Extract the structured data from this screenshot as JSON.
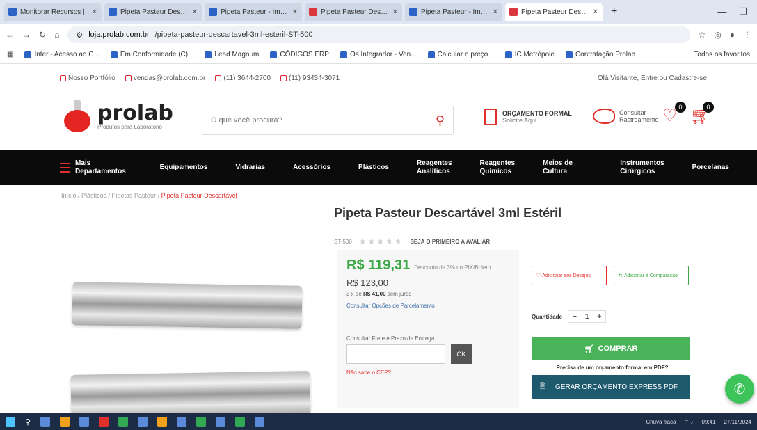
{
  "browser": {
    "tabs": [
      {
        "title": "Monitorar Recursos |",
        "color": "#2b63c6"
      },
      {
        "title": "Pipeta Pasteur Descartáv",
        "color": "#2b63c6"
      },
      {
        "title": "Pipeta Pasteur - ImClean",
        "color": "#2b63c6"
      },
      {
        "title": "Pipeta Pasteur Descartáv",
        "color": "#d9363e"
      },
      {
        "title": "Pipeta Pasteur - ImClean",
        "color": "#2b63c6"
      },
      {
        "title": "Pipeta Pasteur Descartáv",
        "color": "#d9363e"
      }
    ],
    "new_tab": "+",
    "url_host": "loja.prolab.com.br",
    "url_path": "/pipeta-pasteur-descartavel-3ml-esteril-ST-500",
    "bookmarks": [
      "Inter - Acesso ao C...",
      "Em Conformidade (C)...",
      "Lead Magnum",
      "CÓDIGOS ERP",
      "Os Integrador - Ven...",
      "Calcular e preço...",
      "IC Metrópole",
      "Contratação Prolab",
      "Todos os favoritos"
    ]
  },
  "topstrip": {
    "links": [
      "Nosso Portfólio",
      "vendas@prolab.com.br",
      "(11) 3644-2700",
      "(11) 93434-3071"
    ],
    "login": "Olá Visitante, Entre ou Cadastre-se"
  },
  "header": {
    "logo_name": "prolab",
    "logo_tagline": "Produtos para Laboratório",
    "search_placeholder": "O que você procura?",
    "orcamento_title": "ORÇAMENTO FORMAL",
    "orcamento_sub": "Solicite Aqui",
    "pedidos_title": "Consultar",
    "pedidos_sub": "Rastreamento",
    "wishlist_count": "0",
    "cart_count": "0"
  },
  "nav": {
    "menu": "Mais Departamentos",
    "items": [
      "Equipamentos",
      "Vidrarias",
      "Acessórios",
      "Plásticos",
      "Reagentes Analíticos",
      "Reagentes Químicos",
      "Meios de Cultura",
      "Instrumentos Cirúrgicos",
      "Porcelanas"
    ]
  },
  "breadcrumb": {
    "path": "Início / Plásticos / Pipetas Pasteur / ",
    "current": "Pipeta Pasteur Descartável"
  },
  "product": {
    "title": "Pipeta Pasteur Descartável 3ml Estéril",
    "sku": "ST-500",
    "review_link": "SEJA O PRIMEIRO A AVALIAR",
    "price": "R$ 119,31",
    "price_note": "Desconto de 3% no PIX/Boleto",
    "old_price": "R$ 123,00",
    "installments_prefix": "3 x de",
    "installments_value": "R$ 41,00",
    "installments_suffix": "sem juros",
    "parcel_link": "Consultar Opções de Parcelamento",
    "freight_label": "Consultar Frete e Prazo de Entrega",
    "freight_placeholder": "",
    "ok_label": "OK",
    "cep_link": "Não sabe o CEP?",
    "btn_wishlist": "Adicionar aos Desejos",
    "btn_compare": "Adicionar à Comparação",
    "qty_label": "Quantidade",
    "qty_value": "1",
    "buy_label": "COMPRAR",
    "express_note": "Precisa de um orçamento formal em PDF?",
    "pdf_label": "GERAR ORÇAMENTO EXPRESS PDF"
  },
  "taskbar": {
    "weather": "Chuva fraca",
    "time": "09:41",
    "date": "27/11/2024"
  }
}
